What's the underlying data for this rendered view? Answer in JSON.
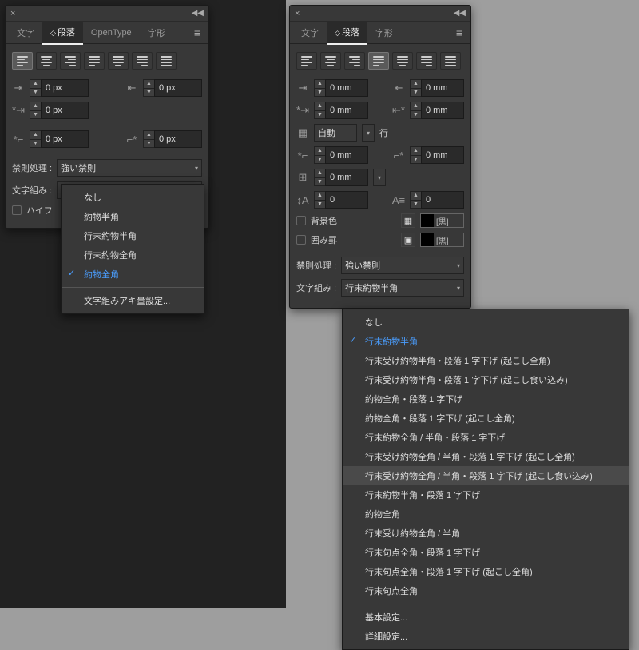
{
  "left_panel": {
    "tabs": [
      "文字",
      "段落",
      "OpenType",
      "字形"
    ],
    "active_tab": 1,
    "left_indent": "0 px",
    "right_indent": "0 px",
    "first_line": "0 px",
    "space_before": "0 px",
    "space_after": "0 px",
    "kinsoku_label": "禁則処理 :",
    "kinsoku_value": "強い禁則",
    "mojikumi_label": "文字組み :",
    "mojikumi_value": "約物全角",
    "hyphen_label": "ハイフ",
    "dropdown": {
      "items": [
        {
          "label": "なし"
        },
        {
          "label": "約物半角"
        },
        {
          "label": "行末約物半角"
        },
        {
          "label": "行末約物全角"
        },
        {
          "label": "約物全角",
          "selected": true
        }
      ],
      "footer": "文字組みアキ量設定..."
    }
  },
  "right_panel": {
    "tabs": [
      "文字",
      "段落",
      "字形"
    ],
    "active_tab": 1,
    "left_indent": "0 mm",
    "right_indent": "0 mm",
    "first_line": "0 mm",
    "last_line": "0 mm",
    "grid_value": "自動",
    "grid_unit": "行",
    "space_before": "0 mm",
    "space_after": "0 mm",
    "bottom_offset": "0 mm",
    "dropchar_lines": "0",
    "dropchar_chars": "0",
    "bgcolor_label": "背景色",
    "border_label": "囲み罫",
    "swatch_label": "[黒]",
    "kinsoku_label": "禁則処理 :",
    "kinsoku_value": "強い禁則",
    "mojikumi_label": "文字組み :",
    "mojikumi_value": "行末約物半角",
    "dropdown": {
      "items": [
        {
          "label": "なし"
        },
        {
          "label": "行末約物半角",
          "selected": true
        },
        {
          "label": "行末受け約物半角・段落 1 字下げ (起こし全角)"
        },
        {
          "label": "行末受け約物半角・段落 1 字下げ (起こし食い込み)"
        },
        {
          "label": "約物全角・段落 1 字下げ"
        },
        {
          "label": "約物全角・段落 1 字下げ (起こし全角)"
        },
        {
          "label": "行末約物全角 / 半角・段落 1 字下げ"
        },
        {
          "label": "行末受け約物全角 / 半角・段落 1 字下げ (起こし全角)"
        },
        {
          "label": "行末受け約物全角 / 半角・段落 1 字下げ (起こし食い込み)",
          "highlighted": true
        },
        {
          "label": "行末約物半角・段落 1 字下げ"
        },
        {
          "label": "約物全角"
        },
        {
          "label": "行末受け約物全角 / 半角"
        },
        {
          "label": "行末句点全角・段落 1 字下げ"
        },
        {
          "label": "行末句点全角・段落 1 字下げ (起こし全角)"
        },
        {
          "label": "行末句点全角"
        }
      ],
      "basic": "基本設定...",
      "detail": "詳細設定..."
    }
  }
}
